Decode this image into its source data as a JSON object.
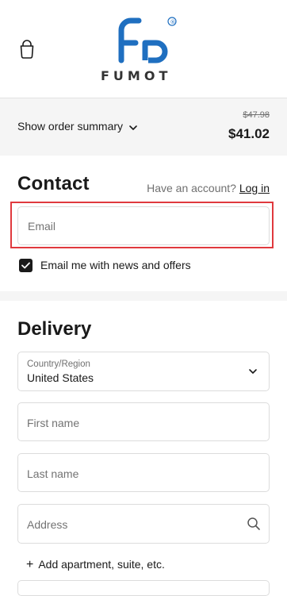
{
  "header": {
    "logo_text": "FUMOT",
    "logo_mark": "®"
  },
  "summary": {
    "toggle_label": "Show order summary",
    "original_price": "$47.98",
    "price": "$41.02"
  },
  "contact": {
    "heading": "Contact",
    "have_account": "Have an account?",
    "login_link": "Log in",
    "email_placeholder": "Email",
    "newsletter_label": "Email me with news and offers",
    "newsletter_checked": true
  },
  "delivery": {
    "heading": "Delivery",
    "country_label": "Country/Region",
    "country_value": "United States",
    "first_name_placeholder": "First name",
    "last_name_placeholder": "Last name",
    "address_placeholder": "Address",
    "add_apartment": "Add apartment, suite, etc."
  },
  "colors": {
    "highlight": "#e0393e",
    "logo_blue": "#1f6fc0",
    "logo_dark": "#333333"
  },
  "icons": [
    "shopping-bag-icon",
    "chevron-down-icon",
    "search-icon",
    "checkmark-icon",
    "plus-icon"
  ]
}
